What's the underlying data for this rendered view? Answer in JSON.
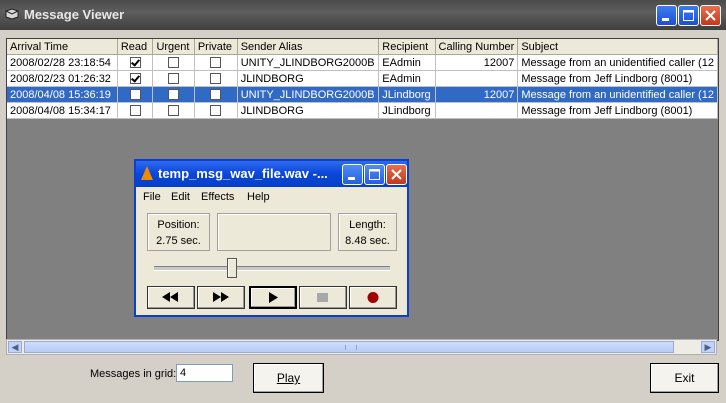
{
  "window": {
    "title": "Message Viewer"
  },
  "grid": {
    "columns": [
      "Arrival Time",
      "Read",
      "Urgent",
      "Private",
      "Sender Alias",
      "Recipient",
      "Calling Number",
      "Subject"
    ],
    "rows": [
      {
        "arrival": "2008/02/28 23:18:54",
        "read": true,
        "urgent": false,
        "private": false,
        "sender": "UNITY_JLINDBORG2000B",
        "recipient": "EAdmin",
        "calling": "12007",
        "subject": "Message from an unidentified caller (12",
        "selected": false
      },
      {
        "arrival": "2008/02/23 01:26:32",
        "read": true,
        "urgent": false,
        "private": false,
        "sender": "JLINDBORG",
        "recipient": "EAdmin",
        "calling": "",
        "subject": "Message from Jeff Lindborg (8001)",
        "selected": false
      },
      {
        "arrival": "2008/04/08 15:36:19",
        "read": false,
        "urgent": false,
        "private": false,
        "sender": "UNITY_JLINDBORG2000B",
        "recipient": "JLindborg",
        "calling": "12007",
        "subject": "Message from an unidentified caller (12",
        "selected": true
      },
      {
        "arrival": "2008/04/08 15:34:17",
        "read": false,
        "urgent": false,
        "private": false,
        "sender": "JLINDBORG",
        "recipient": "JLindborg",
        "calling": "",
        "subject": "Message from Jeff Lindborg (8001)",
        "selected": false
      }
    ]
  },
  "footer": {
    "messages_label": "Messages in grid:",
    "messages_count": "4",
    "play_label": "Play",
    "exit_label": "Exit"
  },
  "player": {
    "title": "temp_msg_wav_file.wav -...",
    "menu": [
      "File",
      "Edit",
      "Effects",
      "Help"
    ],
    "position_label": "Position:",
    "position_value": "2.75 sec.",
    "length_label": "Length:",
    "length_value": "8.48 sec.",
    "progress_fraction": 0.324
  },
  "colors": {
    "selection": "#316ac5",
    "titlebar_inactive": "#4a4a4a",
    "dialog_titlebar": "#0a46d8",
    "record": "#a00000"
  }
}
